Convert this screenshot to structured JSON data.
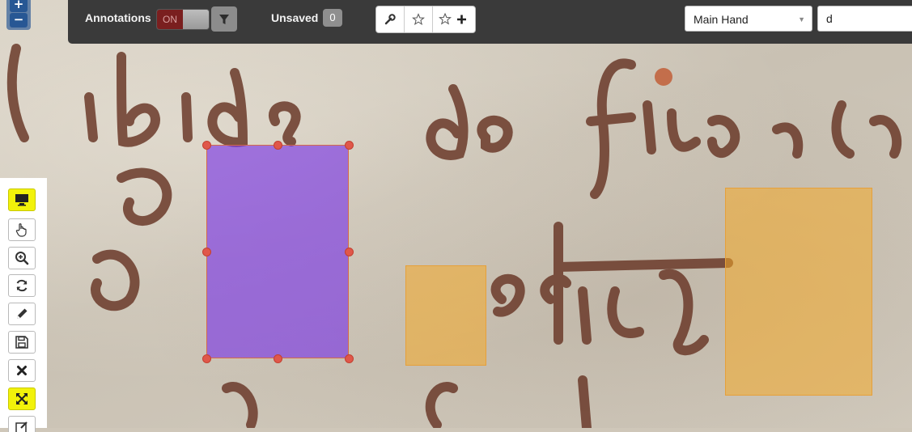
{
  "toolbar": {
    "annotations_label": "Annotations",
    "toggle_on_label": "ON",
    "unsaved_label": "Unsaved",
    "unsaved_count": "0",
    "hand_select_value": "Main Hand",
    "search_value": "d"
  },
  "zoom": {
    "in_label": "+",
    "out_label": "−"
  },
  "icons": {
    "filter": "filter-icon",
    "wrench": "wrench-icon",
    "star": "star-icon",
    "star_plus": "star-plus-icon",
    "display": "monitor-icon",
    "pan": "hand-pointer-icon",
    "zoom": "zoom-in-icon",
    "refresh": "refresh-icon",
    "edit": "pencil-icon",
    "save": "save-icon",
    "delete": "close-icon",
    "fit": "expand-icon"
  },
  "colors": {
    "toolbar_bg": "#3a3a3a",
    "active_tool": "#f2f20a",
    "selected_annotation": "#7832e6",
    "annotation": "#f4aa28",
    "handle": "#e0574a",
    "toggle_on": "#7a1f1f"
  }
}
